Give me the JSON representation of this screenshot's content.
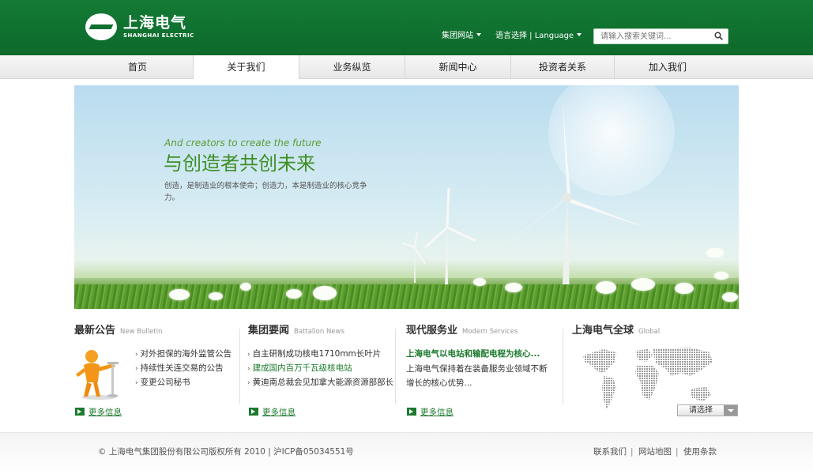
{
  "header": {
    "logo_cn": "上海电气",
    "logo_en": "SHANGHAI ELECTRIC",
    "group_sites": "集团网站",
    "language": "语言选择 | Language",
    "search_placeholder": "请输入搜索关键词..."
  },
  "nav": {
    "items": [
      {
        "label": "首页"
      },
      {
        "label": "关于我们"
      },
      {
        "label": "业务纵览"
      },
      {
        "label": "新闻中心"
      },
      {
        "label": "投资者关系"
      },
      {
        "label": "加入我们"
      }
    ],
    "active_index": 1
  },
  "banner": {
    "english_tagline": "And creators to create the future",
    "title": "与创造者共创未来",
    "description": "创造，是制造业的根本使命；创造力，本是制造业的核心竞争力。"
  },
  "bulletin": {
    "title": "最新公告",
    "subtitle": "New Bulletin",
    "items": [
      "对外担保的海外监管公告",
      "持续性关连交易的公告",
      "变更公司秘书"
    ],
    "more": "更多信息"
  },
  "news": {
    "title": "集团要闻",
    "subtitle": "Battalion News",
    "items": [
      "自主研制成功核电1710mm长叶片",
      "建成国内百万千瓦级核电站",
      "黄迪南总裁会见加拿大能源资源部部长"
    ],
    "more": "更多信息"
  },
  "services": {
    "title": "现代服务业",
    "subtitle": "Modern Services",
    "headline": "上海电气以电站和输配电程为核心...",
    "body": "上海电气保持着在装备服务业领域不断增长的核心优势...",
    "more": "更多信息"
  },
  "global": {
    "title": "上海电气全球",
    "subtitle": "Global",
    "select_label": "请选择"
  },
  "footer": {
    "copyright": "© 上海电气集团股份有限公司版权所有  2010 | 沪ICP备05034551号",
    "links": [
      "联系我们",
      "网站地图",
      "使用条款"
    ],
    "separator": "|"
  },
  "colors": {
    "brand_green": "#0f6f2f",
    "link_green": "#1c7a2e"
  }
}
